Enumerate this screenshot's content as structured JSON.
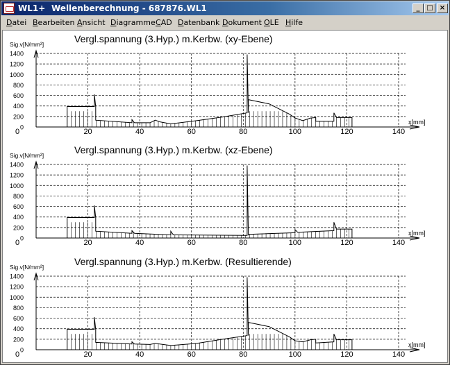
{
  "window": {
    "app_name": "WL1+",
    "title": "Wellenberechnung  -  687876.WL1",
    "buttons": {
      "minimize": "_",
      "maximize": "□",
      "close": "×"
    }
  },
  "menu": [
    {
      "label": "Datei",
      "mnemonic": 0
    },
    {
      "label": "Bearbeiten",
      "mnemonic": 0
    },
    {
      "label": "Ansicht",
      "mnemonic": 0
    },
    {
      "label": "Diagramme",
      "mnemonic": 0
    },
    {
      "label": "CAD",
      "mnemonic": 0
    },
    {
      "label": "Datenbank",
      "mnemonic": 0
    },
    {
      "label": "Dokument",
      "mnemonic": 0
    },
    {
      "label": "OLE",
      "mnemonic": 0
    },
    {
      "label": "Hilfe",
      "mnemonic": 0
    }
  ],
  "chart_data": [
    {
      "type": "area",
      "title": "Vergl.spannung (3.Hyp.) m.Kerbw. (xy-Ebene)",
      "ylabel": "Sig.v[N/mm²]",
      "xlabel": "x[mm]",
      "x_origin_label": "0",
      "xlim": [
        0,
        140
      ],
      "ylim": [
        0,
        1400
      ],
      "xticks": [
        20,
        40,
        60,
        80,
        100,
        120,
        140
      ],
      "yticks": [
        0,
        200,
        400,
        600,
        800,
        1000,
        1200,
        1400
      ],
      "grid": true,
      "points": [
        [
          12,
          0
        ],
        [
          12,
          390
        ],
        [
          22.5,
          390
        ],
        [
          22.5,
          620
        ],
        [
          23,
          390
        ],
        [
          23,
          130
        ],
        [
          37,
          80
        ],
        [
          37,
          140
        ],
        [
          38,
          80
        ],
        [
          44,
          80
        ],
        [
          46,
          130
        ],
        [
          48,
          95
        ],
        [
          52,
          60
        ],
        [
          62,
          120
        ],
        [
          72,
          190
        ],
        [
          81.5,
          270
        ],
        [
          81.5,
          1380
        ],
        [
          82,
          270
        ],
        [
          82,
          520
        ],
        [
          90,
          440
        ],
        [
          98,
          240
        ],
        [
          100,
          170
        ],
        [
          103,
          120
        ],
        [
          106,
          170
        ],
        [
          108,
          180
        ],
        [
          108,
          110
        ],
        [
          115,
          110
        ],
        [
          115,
          270
        ],
        [
          116,
          180
        ],
        [
          122,
          180
        ],
        [
          122,
          0
        ]
      ]
    },
    {
      "type": "area",
      "title": "Vergl.spannung (3.Hyp.) m.Kerbw. (xz-Ebene)",
      "ylabel": "Sig.v[N/mm²]",
      "xlabel": "x[mm]",
      "x_origin_label": "0",
      "xlim": [
        0,
        140
      ],
      "ylim": [
        0,
        1400
      ],
      "xticks": [
        20,
        40,
        60,
        80,
        100,
        120,
        140
      ],
      "yticks": [
        0,
        200,
        400,
        600,
        800,
        1000,
        1200,
        1400
      ],
      "grid": true,
      "points": [
        [
          12,
          0
        ],
        [
          12,
          390
        ],
        [
          22.5,
          390
        ],
        [
          22.5,
          620
        ],
        [
          23,
          390
        ],
        [
          23,
          130
        ],
        [
          37,
          90
        ],
        [
          37,
          140
        ],
        [
          38,
          90
        ],
        [
          52,
          60
        ],
        [
          52,
          130
        ],
        [
          53,
          60
        ],
        [
          81.5,
          50
        ],
        [
          81.5,
          1380
        ],
        [
          82,
          50
        ],
        [
          82,
          70
        ],
        [
          100,
          100
        ],
        [
          100,
          160
        ],
        [
          101,
          110
        ],
        [
          115,
          140
        ],
        [
          115,
          300
        ],
        [
          116,
          170
        ],
        [
          122,
          170
        ],
        [
          122,
          0
        ]
      ]
    },
    {
      "type": "area",
      "title": "Vergl.spannung (3.Hyp.) m.Kerbw. (Resultierende)",
      "ylabel": "Sig.v[N/mm²]",
      "xlabel": "x[mm]",
      "x_origin_label": "0",
      "xlim": [
        0,
        140
      ],
      "ylim": [
        0,
        1400
      ],
      "xticks": [
        20,
        40,
        60,
        80,
        100,
        120,
        140
      ],
      "yticks": [
        0,
        200,
        400,
        600,
        800,
        1000,
        1200,
        1400
      ],
      "grid": true,
      "points": [
        [
          12,
          0
        ],
        [
          12,
          390
        ],
        [
          22.5,
          390
        ],
        [
          22.5,
          620
        ],
        [
          23,
          390
        ],
        [
          23,
          140
        ],
        [
          37,
          110
        ],
        [
          37,
          150
        ],
        [
          38,
          110
        ],
        [
          44,
          100
        ],
        [
          46,
          120
        ],
        [
          52,
          80
        ],
        [
          62,
          120
        ],
        [
          72,
          200
        ],
        [
          81.5,
          270
        ],
        [
          81.5,
          1380
        ],
        [
          82,
          270
        ],
        [
          82,
          520
        ],
        [
          90,
          440
        ],
        [
          98,
          240
        ],
        [
          100,
          170
        ],
        [
          103,
          150
        ],
        [
          106,
          190
        ],
        [
          108,
          200
        ],
        [
          108,
          130
        ],
        [
          115,
          150
        ],
        [
          115,
          300
        ],
        [
          116,
          190
        ],
        [
          122,
          190
        ],
        [
          122,
          0
        ]
      ]
    }
  ]
}
